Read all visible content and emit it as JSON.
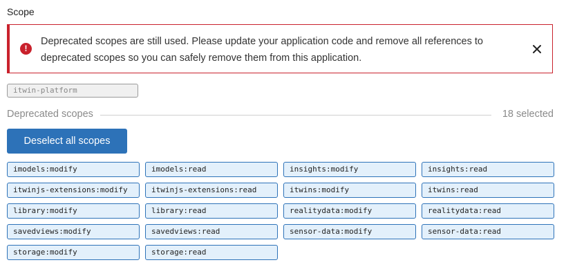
{
  "section_title": "Scope",
  "alert": {
    "message": "Deprecated scopes are still used. Please update your application code and remove all references to deprecated scopes so you can safely remove them from this application.",
    "icon": "error-icon",
    "close_icon": "close-icon",
    "color": "#c9212c"
  },
  "platform_scope": "itwin-platform",
  "deprecated": {
    "label": "Deprecated scopes",
    "count_text": "18 selected",
    "deselect_label": "Deselect all scopes",
    "accent": "#2d72b8",
    "scopes": [
      "imodels:modify",
      "imodels:read",
      "insights:modify",
      "insights:read",
      "itwinjs-extensions:modify",
      "itwinjs-extensions:read",
      "itwins:modify",
      "itwins:read",
      "library:modify",
      "library:read",
      "realitydata:modify",
      "realitydata:read",
      "savedviews:modify",
      "savedviews:read",
      "sensor-data:modify",
      "sensor-data:read",
      "storage:modify",
      "storage:read"
    ]
  }
}
